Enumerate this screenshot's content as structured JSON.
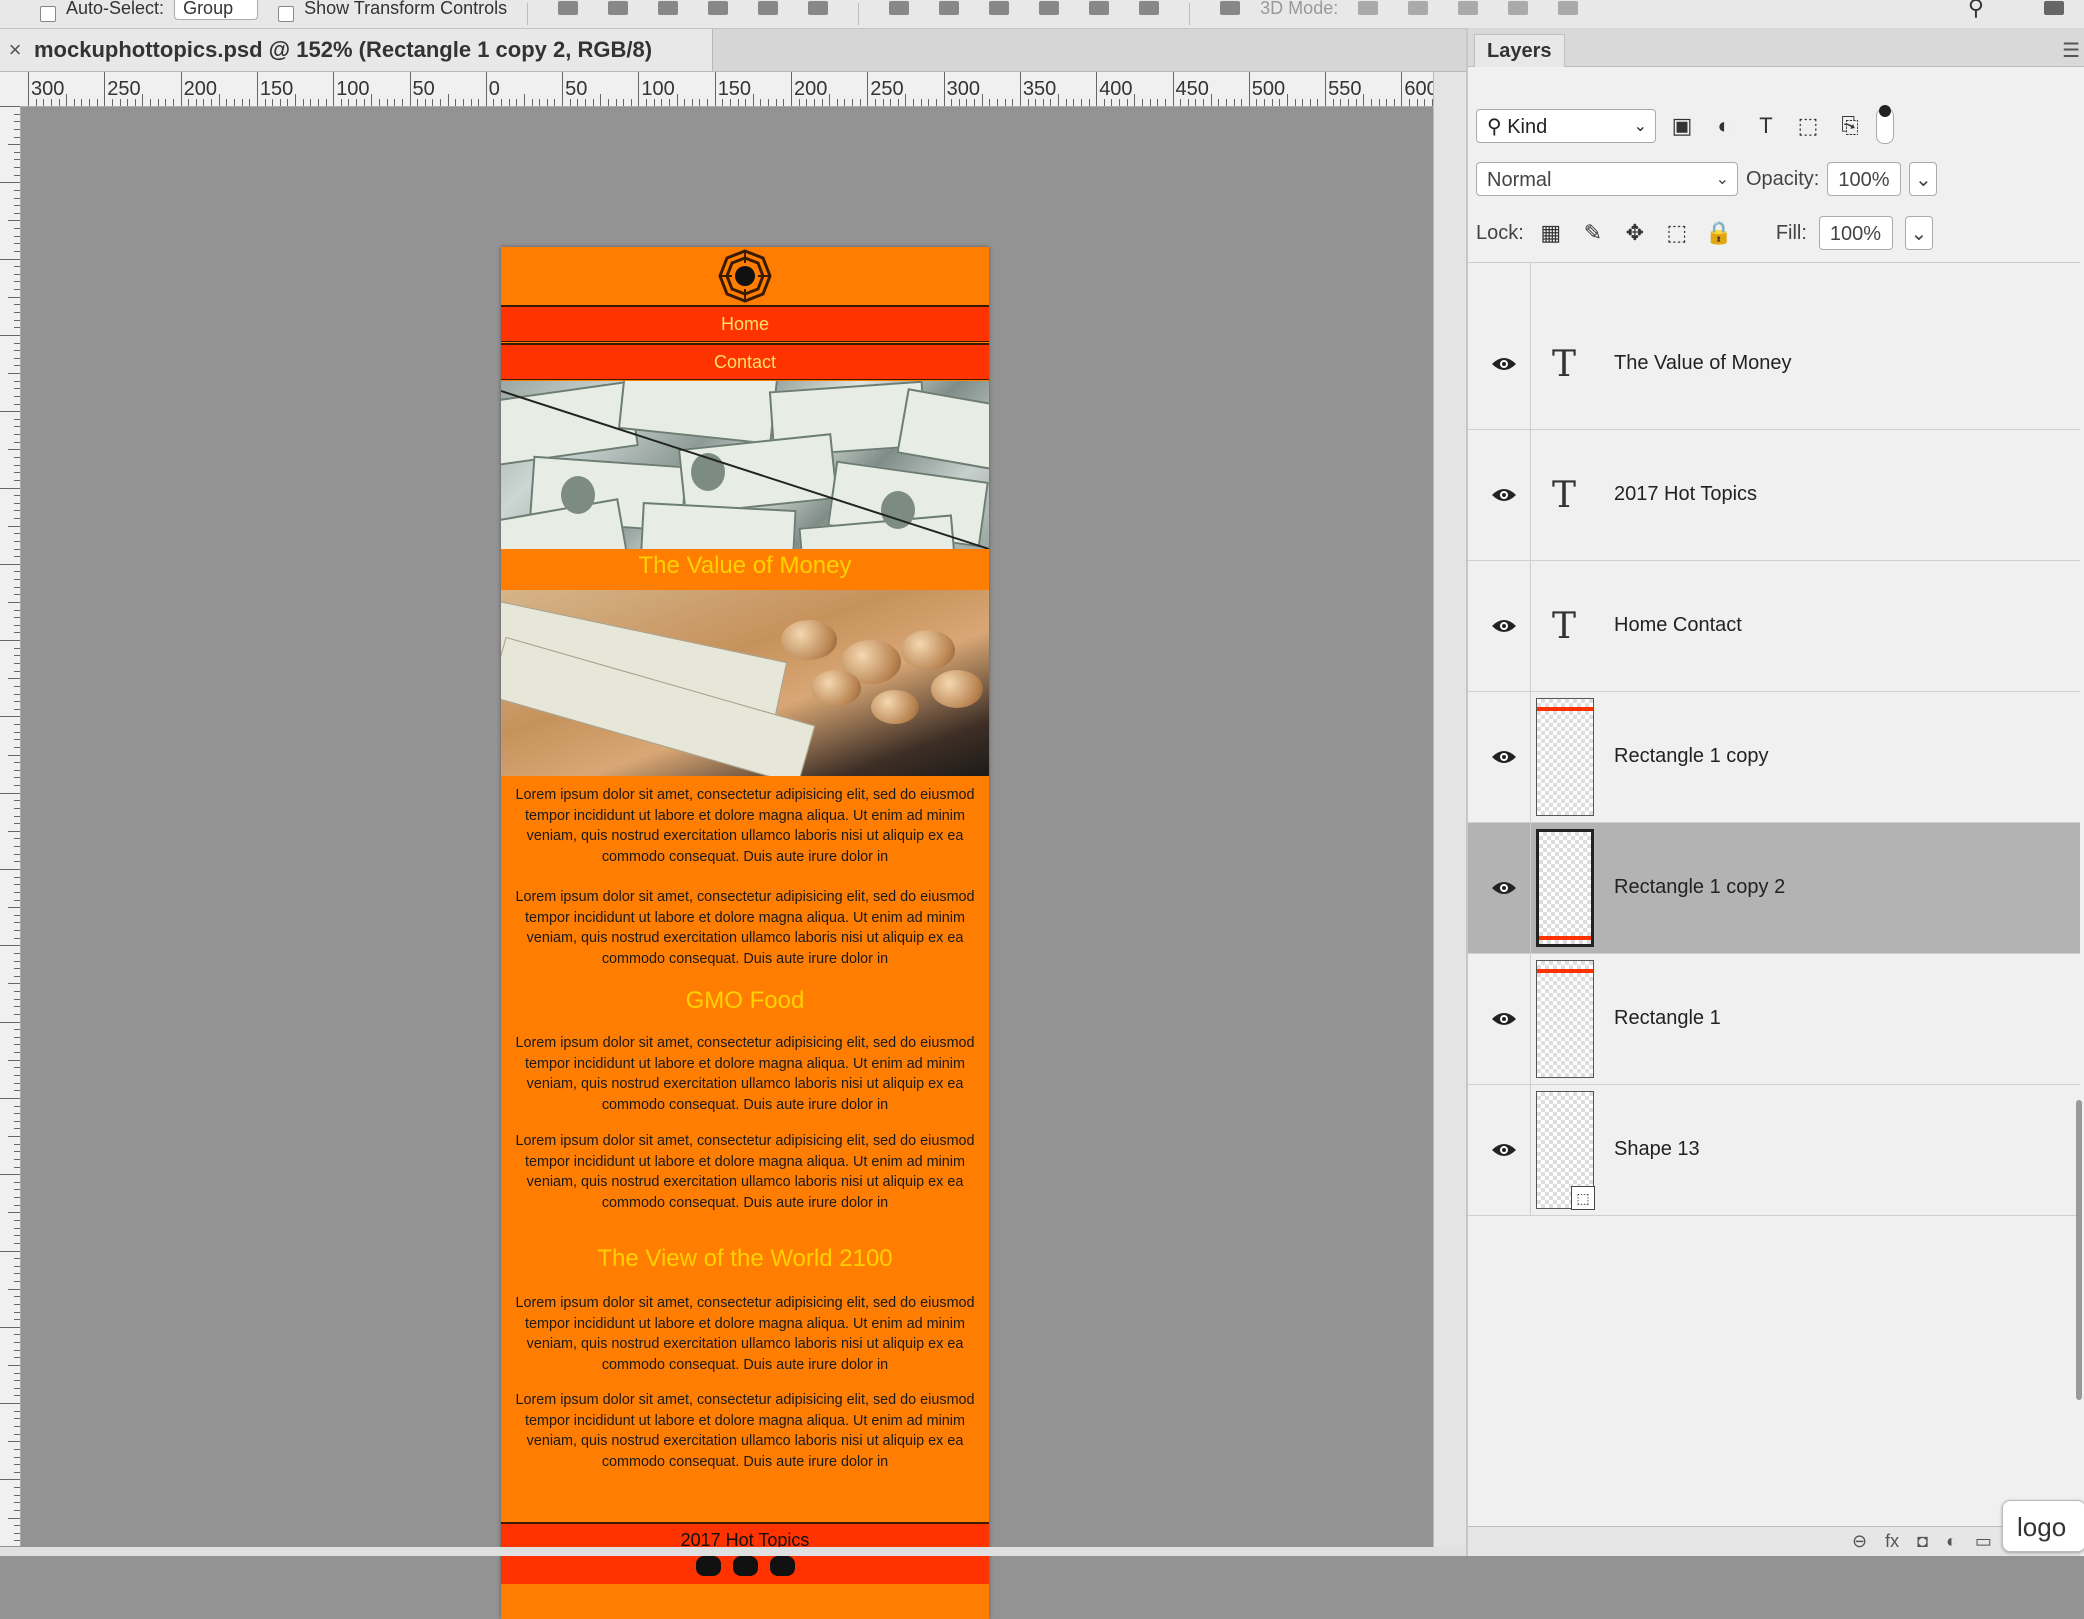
{
  "options_bar": {
    "auto_select_label": "Auto-Select:",
    "auto_select_value": "Group",
    "show_transform_label": "Show Transform Controls",
    "mode_3d_label": "3D Mode:"
  },
  "document": {
    "tab_title": "mockuphottopics.psd @ 152% (Rectangle 1 copy 2, RGB/8)",
    "close_glyph": "×",
    "ruler_labels": [
      "300",
      "250",
      "200",
      "150",
      "100",
      "50",
      "0",
      "50",
      "100",
      "150",
      "200",
      "250",
      "300",
      "350",
      "400",
      "450",
      "500",
      "550",
      "600"
    ]
  },
  "mockup": {
    "nav_home": "Home",
    "nav_contact": "Contact",
    "section1_title": "The Value of Money",
    "section2_title": "GMO Food",
    "section3_title": "The View of the World 2100",
    "lorem": "Lorem ipsum dolor sit amet, consectetur adipisicing elit, sed do eiusmod tempor incididunt ut labore et dolore magna aliqua. Ut enim ad minim veniam, quis nostrud exercitation ullamco laboris nisi ut aliquip ex ea commodo consequat. Duis aute irure dolor in",
    "footer_title": "2017 Hot Topics",
    "colors": {
      "background": "#ff7d00",
      "nav": "#ff3300",
      "heading": "#ffd100",
      "nav_text": "#ffe066"
    }
  },
  "layers_panel": {
    "tab_label": "Layers",
    "filter_kind": "Kind",
    "blend_mode": "Normal",
    "opacity_label": "Opacity:",
    "opacity_value": "100%",
    "lock_label": "Lock:",
    "fill_label": "Fill:",
    "fill_value": "100%",
    "layers": [
      {
        "name": "The Value of Money",
        "type": "text",
        "visible": true,
        "selected": false
      },
      {
        "name": "2017 Hot Topics",
        "type": "text",
        "visible": true,
        "selected": false
      },
      {
        "name": "Home  Contact",
        "type": "text",
        "visible": true,
        "selected": false
      },
      {
        "name": "Rectangle 1 copy",
        "type": "raster",
        "visible": true,
        "selected": false
      },
      {
        "name": "Rectangle 1 copy 2",
        "type": "raster",
        "visible": true,
        "selected": true
      },
      {
        "name": "Rectangle 1",
        "type": "raster",
        "visible": true,
        "selected": false
      },
      {
        "name": "Shape 13",
        "type": "shape",
        "visible": true,
        "selected": false
      }
    ]
  },
  "tooltip": "logo"
}
